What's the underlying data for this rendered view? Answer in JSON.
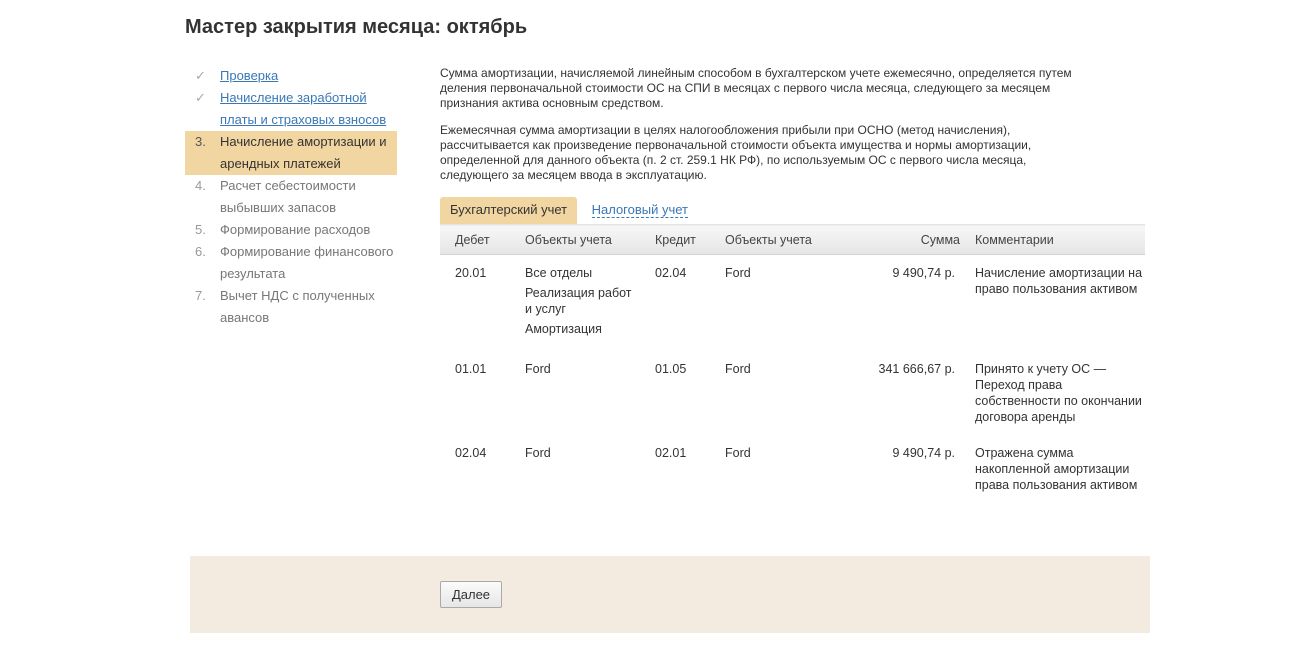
{
  "title": "Мастер закрытия месяца: октябрь",
  "steps": [
    {
      "marker": "✓",
      "label_lines": [
        "Проверка"
      ],
      "state": "done"
    },
    {
      "marker": "✓",
      "label_lines": [
        "Начисление заработной",
        "платы и страховых взносов"
      ],
      "state": "done"
    },
    {
      "marker": "3.",
      "label_lines": [
        "Начисление амортизации и",
        "арендных платежей"
      ],
      "state": "active"
    },
    {
      "marker": "4.",
      "label_lines": [
        "Расчет себестоимости",
        "выбывших запасов"
      ],
      "state": "pending"
    },
    {
      "marker": "5.",
      "label_lines": [
        "Формирование расходов"
      ],
      "state": "pending"
    },
    {
      "marker": "6.",
      "label_lines": [
        "Формирование финансового",
        "результата"
      ],
      "state": "pending"
    },
    {
      "marker": "7.",
      "label_lines": [
        "Вычет НДС с полученных",
        "авансов"
      ],
      "state": "pending"
    }
  ],
  "paragraphs": [
    [
      "Сумма амортизации, начисляемой линейным способом в бухгалтерском учете ежемесячно, определяется путем",
      "деления первоначальной стоимости ОС на СПИ в месяцах с первого числа месяца, следующего за месяцем",
      "признания актива основным средством."
    ],
    [
      "Ежемесячная сумма амортизации в целях налогообложения прибыли при ОСНО (метод начисления),",
      "рассчитывается как произведение первоначальной стоимости объекта имущества и нормы амортизации,",
      "определенной для данного объекта (п. 2 ст. 259.1 НК РФ), по используемым ОС с первого числа месяца,",
      "следующего за месяцем ввода в эксплуатацию."
    ]
  ],
  "tabs": {
    "accounting": "Бухгалтерский учет",
    "tax": "Налоговый учет"
  },
  "table": {
    "headers": {
      "debit": "Дебет",
      "debit_objects": "Объекты учета",
      "credit": "Кредит",
      "credit_objects": "Объекты учета",
      "sum": "Сумма",
      "comment": "Комментарии"
    },
    "rows": [
      {
        "debit": "20.01",
        "debit_objects": [
          "Все отделы",
          "Реализация работ\nи услуг",
          "Амортизация"
        ],
        "credit": "02.04",
        "credit_objects": "Ford",
        "sum": "9 490,74 р.",
        "comment": "Начисление амортизации на право пользования активом"
      },
      {
        "debit": "01.01",
        "debit_objects": [
          "Ford"
        ],
        "credit": "01.05",
        "credit_objects": "Ford",
        "sum": "341 666,67 р.",
        "comment": "Принято к учету ОС — Переход права собственности по окончании договора аренды"
      },
      {
        "debit": "02.04",
        "debit_objects": [
          "Ford"
        ],
        "credit": "02.01",
        "credit_objects": "Ford",
        "sum": "9 490,74 р.",
        "comment": "Отражена сумма накопленной амортизации права пользования активом"
      }
    ]
  },
  "footer": {
    "next_label": "Далее"
  },
  "colors": {
    "active_highlight": "#f2d6a2",
    "link": "#3a78b5",
    "footer_bg": "#f3ebe0"
  }
}
